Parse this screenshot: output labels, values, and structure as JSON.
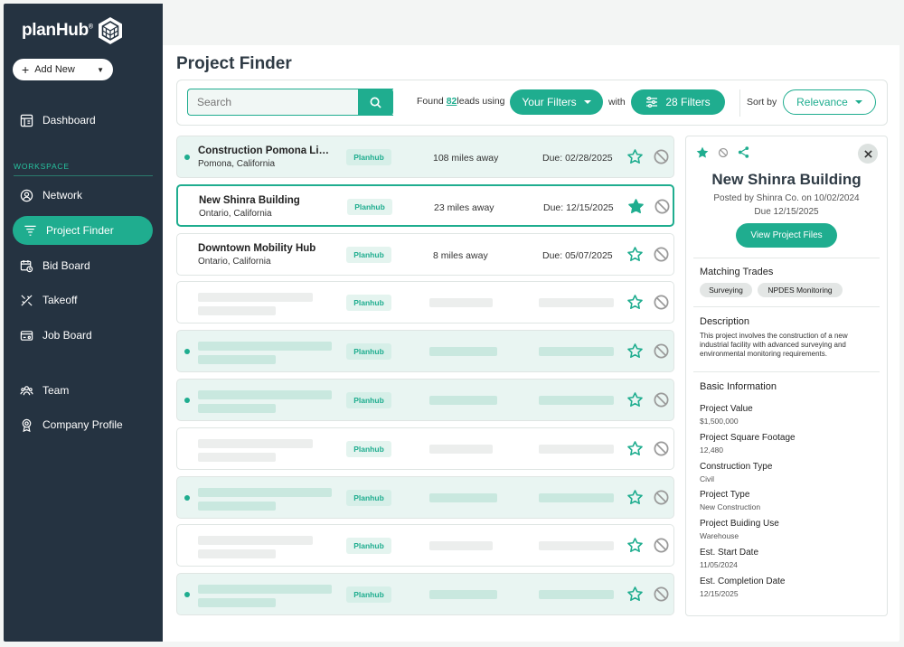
{
  "app": {
    "brand": "planHub",
    "brand_mark": "®"
  },
  "sidebar": {
    "add_new": "Add New",
    "items_top": [
      {
        "label": "Dashboard",
        "icon": "dashboard-icon"
      }
    ],
    "workspace_label": "WORKSPACE",
    "items": [
      {
        "label": "Network",
        "icon": "user-circle-icon"
      },
      {
        "label": "Project Finder",
        "icon": "funnel-icon",
        "active": true
      },
      {
        "label": "Bid Board",
        "icon": "calendar-clock-icon"
      },
      {
        "label": "Takeoff",
        "icon": "ruler-tools-icon"
      },
      {
        "label": "Job Board",
        "icon": "id-card-icon"
      }
    ],
    "items_bottom": [
      {
        "label": "Team",
        "icon": "team-icon"
      },
      {
        "label": "Company Profile",
        "icon": "badge-icon"
      }
    ]
  },
  "main": {
    "title": "Project Finder",
    "search": {
      "placeholder": "Search"
    },
    "found_prefix": "Found",
    "found_count": "82",
    "found_suffix": "leads using",
    "your_filters": "Your Filters",
    "with": "with",
    "filters_count_label": "28 Filters",
    "sort_by": "Sort by",
    "sort_value": "Relevance"
  },
  "rows": [
    {
      "title": "Construction Pomona Libr...",
      "location": "Pomona, California",
      "tag": "Planhub",
      "distance": "108 miles away",
      "due": "Due: 02/28/2025",
      "starred": false,
      "unread": true,
      "tint": true
    },
    {
      "title": "New Shinra Building",
      "location": "Ontario, California",
      "tag": "Planhub",
      "distance": "23 miles away",
      "due": "Due:  12/15/2025",
      "starred": true,
      "unread": false,
      "selected": true
    },
    {
      "title": "Downtown Mobility Hub",
      "location": "Ontario, California",
      "tag": "Planhub",
      "distance": "8 miles away",
      "due": "Due: 05/07/2025",
      "starred": false,
      "unread": false
    },
    {
      "tag": "Planhub",
      "placeholder": true,
      "tint": false,
      "unread": false
    },
    {
      "tag": "Planhub",
      "placeholder": true,
      "tint": true,
      "unread": true
    },
    {
      "tag": "Planhub",
      "placeholder": true,
      "tint": true,
      "unread": true
    },
    {
      "tag": "Planhub",
      "placeholder": true,
      "tint": false,
      "unread": false
    },
    {
      "tag": "Planhub",
      "placeholder": true,
      "tint": true,
      "unread": true
    },
    {
      "tag": "Planhub",
      "placeholder": true,
      "tint": false,
      "unread": false
    },
    {
      "tag": "Planhub",
      "placeholder": true,
      "tint": true,
      "unread": true
    }
  ],
  "detail": {
    "title": "New Shinra Building",
    "posted_by": "Posted by Shinra Co. on 10/02/2024",
    "due": "Due 12/15/2025",
    "view_files": "View Project Files",
    "matching_trades_h": "Matching Trades",
    "trades": [
      "Surveying",
      "NPDES Monitoring"
    ],
    "description_h": "Description",
    "description": "This project involves the construction of a new industrial facility with advanced surveying and environmental monitoring requirements.",
    "basic_info_h": "Basic Information",
    "info": [
      {
        "label": "Project Value",
        "value": "$1,500,000"
      },
      {
        "label": "Project Square Footage",
        "value": "12,480"
      },
      {
        "label": "Construction Type",
        "value": "Civil"
      },
      {
        "label": "Project Type",
        "value": "New Construction"
      },
      {
        "label": "Project Buiding Use",
        "value": "Warehouse"
      },
      {
        "label": "Est. Start Date",
        "value": "11/05/2024"
      },
      {
        "label": "Est. Completion Date",
        "value": "12/15/2025"
      }
    ]
  },
  "colors": {
    "accent": "#1fad8f",
    "sidebar": "#253341",
    "tint": "#e9f5f2"
  }
}
